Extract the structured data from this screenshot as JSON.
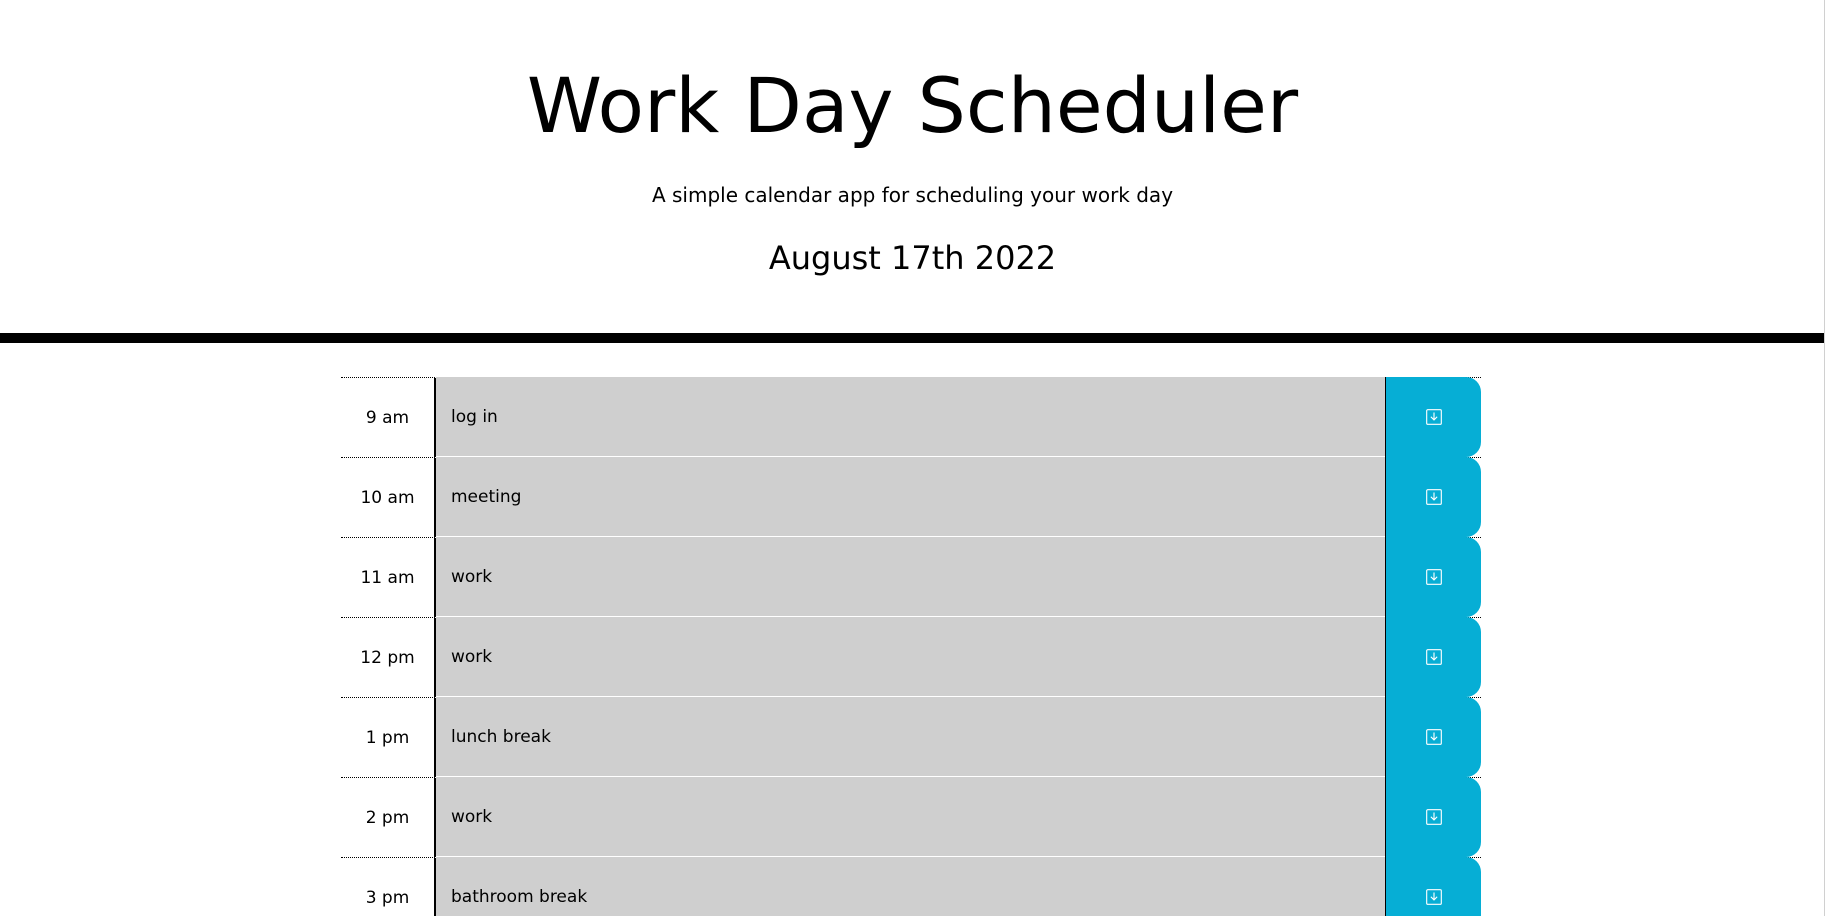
{
  "header": {
    "title": "Work Day Scheduler",
    "subtitle": "A simple calendar app for scheduling your work day",
    "current_day": "August 17th 2022"
  },
  "colors": {
    "past": "#cfcfcf",
    "save_button": "#06aed5"
  },
  "icons": {
    "save": "save-icon"
  },
  "schedule": [
    {
      "hour": "9 am",
      "description": "log in"
    },
    {
      "hour": "10 am",
      "description": "meeting"
    },
    {
      "hour": "11 am",
      "description": "work"
    },
    {
      "hour": "12 pm",
      "description": "work"
    },
    {
      "hour": "1 pm",
      "description": "lunch break"
    },
    {
      "hour": "2 pm",
      "description": "work"
    },
    {
      "hour": "3 pm",
      "description": "bathroom break"
    }
  ]
}
